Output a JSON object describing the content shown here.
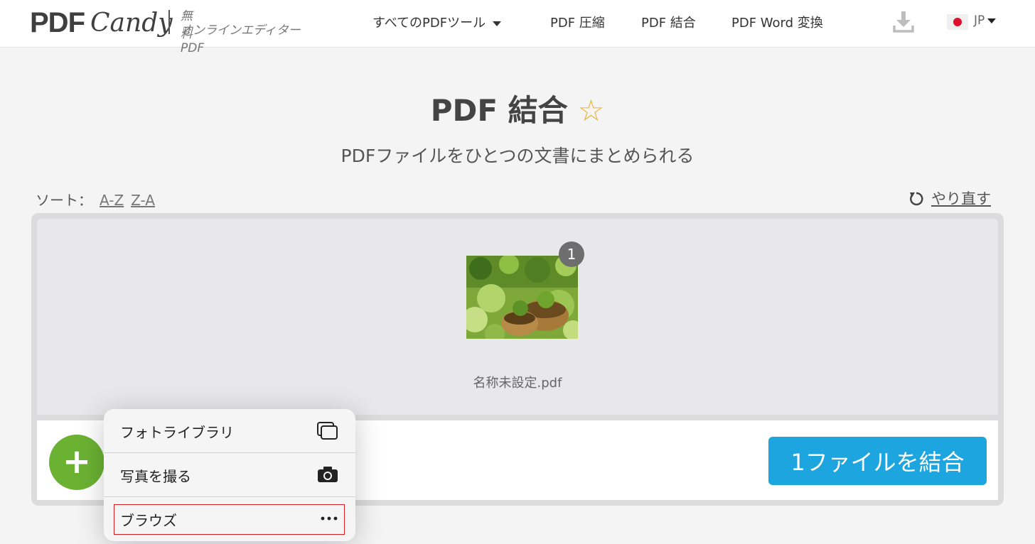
{
  "header": {
    "logo_pdf": "PDF",
    "logo_candy": "Candy",
    "tagline_1": "無料PDF",
    "tagline_2": "オンラインエディター",
    "nav": {
      "all_tools": "すべてのPDFツール",
      "compress": "PDF 圧縮",
      "merge": "PDF 結合",
      "word": "PDF Word 変換"
    },
    "lang": "JP"
  },
  "page": {
    "title": "PDF 結合",
    "star": "☆",
    "subtitle": "PDFファイルをひとつの文書にまとめられる",
    "sort_label": "ソート：",
    "sort_az": "A-Z",
    "sort_za": "Z-A",
    "redo": "やり直す"
  },
  "file": {
    "badge": "1",
    "name": "名称未設定.pdf"
  },
  "actions": {
    "add": "+",
    "merge": "1ファイルを結合"
  },
  "popup": {
    "items": [
      {
        "label": "フォトライブラリ",
        "icon": "photo-library-icon"
      },
      {
        "label": "写真を撮る",
        "icon": "camera-icon"
      },
      {
        "label": "ブラウズ",
        "icon": "more-icon"
      }
    ]
  },
  "colors": {
    "add_green": "#6bb233",
    "merge_blue": "#1da5e0",
    "star_gold": "#e8b53a",
    "highlight_red": "#d81e1e"
  }
}
